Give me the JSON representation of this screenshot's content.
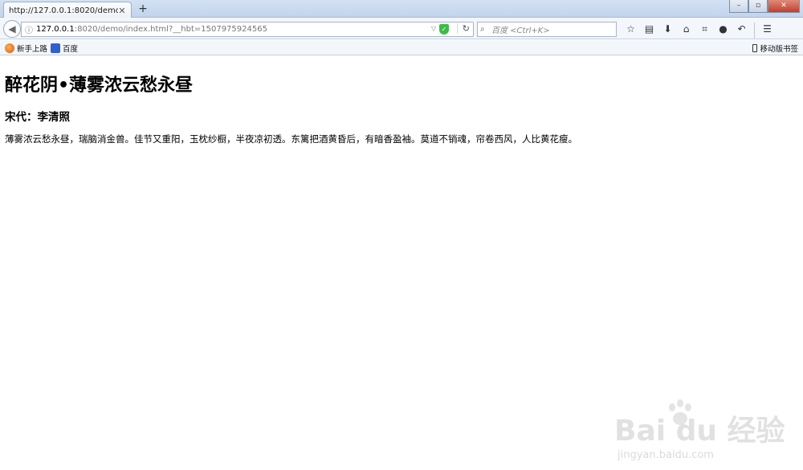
{
  "browser": {
    "tab": {
      "title": "http://127.0.0.1:8020/demo/in",
      "close_glyph": "✕"
    },
    "new_tab_glyph": "+",
    "url": {
      "host": "127.0.0.1",
      "path": ":8020/demo/index.html?__hbt=1507975924565"
    },
    "search": {
      "placeholder": "百度 <Ctrl+K>"
    },
    "bookmarks": [
      {
        "label": "新手上路",
        "icon": "firefox-icon"
      },
      {
        "label": "百度",
        "icon": "baidu-icon"
      }
    ],
    "mobile_bookmarks": "移动版书签",
    "toolbar_icons": [
      "star-icon",
      "reading-list-icon",
      "download-icon",
      "home-icon",
      "crop-icon",
      "chat-icon",
      "undo-icon",
      "menu-icon"
    ]
  },
  "page": {
    "title": "醉花阴•薄雾浓云愁永昼",
    "author": "宋代：李清照",
    "body": "薄雾浓云愁永昼，瑞脑消金兽。佳节又重阳，玉枕纱橱，半夜凉初透。东篱把酒黄昏后，有暗香盈袖。莫道不销魂，帘卷西风，人比黄花瘦。"
  },
  "watermark": {
    "main": "Bai du 经验",
    "sub": "jingyan.baidu.com"
  }
}
